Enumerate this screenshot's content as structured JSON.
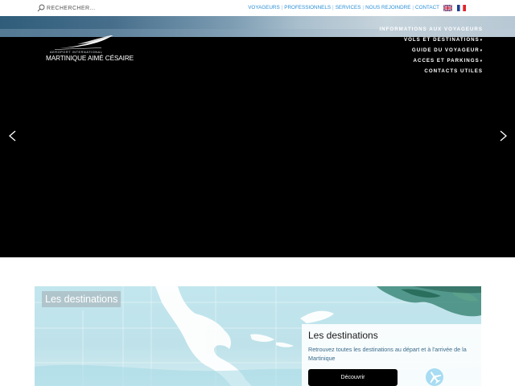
{
  "topbar": {
    "search_placeholder": "RECHERCHER...",
    "links": [
      "VOYAGEURS",
      "PROFESSIONNELS",
      "SERVICES",
      "NOUS REJOINDRE",
      "CONTACT"
    ],
    "link_separator": "|",
    "link_color": "#2a8fd6",
    "flags": [
      "english-flag-icon",
      "french-flag-icon"
    ]
  },
  "hero": {
    "logo": {
      "subtitle": "AEROPORT INTERNATIONAL",
      "title": "MARTINIQUE AIMÉ CÉSAIRE"
    },
    "nav": [
      {
        "label": "INFORMATIONS AUX VOYAGEURS",
        "has_dropdown": false
      },
      {
        "label": "VOLS ET DESTINATIONS",
        "has_dropdown": true
      },
      {
        "label": "GUIDE DU VOYAGEUR",
        "has_dropdown": true
      },
      {
        "label": "ACCES ET PARKINGS",
        "has_dropdown": true
      },
      {
        "label": "CONTACTS UTILES",
        "has_dropdown": false
      }
    ],
    "dropdown_caret": "▾",
    "prev_icon": "chevron-left-icon",
    "next_icon": "chevron-right-icon"
  },
  "promo": {
    "tag": "Les destinations",
    "title": "Les destinations",
    "text": "Retrouvez toutes les destinations au départ et à l'arrivée de la Martinique",
    "button": "Découvrir",
    "badge_icon": "airplane-icon"
  }
}
